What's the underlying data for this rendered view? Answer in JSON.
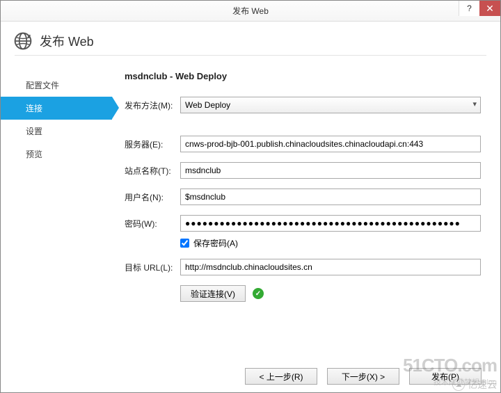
{
  "window": {
    "title": "发布 Web"
  },
  "header": {
    "title": "发布 Web"
  },
  "sidebar": {
    "items": [
      {
        "label": "配置文件"
      },
      {
        "label": "连接"
      },
      {
        "label": "设置"
      },
      {
        "label": "预览"
      }
    ],
    "activeIndex": 1
  },
  "main": {
    "heading": "msdnclub - Web Deploy",
    "publishMethod": {
      "label": "发布方法(M):",
      "value": "Web Deploy"
    },
    "server": {
      "label": "服务器(E):",
      "value": "cnws-prod-bjb-001.publish.chinacloudsites.chinacloudapi.cn:443"
    },
    "siteName": {
      "label": "站点名称(T):",
      "value": "msdnclub"
    },
    "userName": {
      "label": "用户名(N):",
      "value": "$msdnclub"
    },
    "password": {
      "label": "密码(W):",
      "value": "●●●●●●●●●●●●●●●●●●●●●●●●●●●●●●●●●●●●●●●●●●●●●●●●"
    },
    "savePassword": {
      "label": "保存密码(A)",
      "checked": true
    },
    "destUrl": {
      "label": "目标 URL(L):",
      "value": "http://msdnclub.chinacloudsites.cn"
    },
    "verify": {
      "label": "验证连接(V)"
    }
  },
  "footer": {
    "prev": "< 上一步(R)",
    "next": "下一步(X) >",
    "publish": "发布(P)"
  },
  "watermark": {
    "line1": "51CTO.com",
    "line2": "技术成就梦想  Blog",
    "brand": "亿速云"
  }
}
